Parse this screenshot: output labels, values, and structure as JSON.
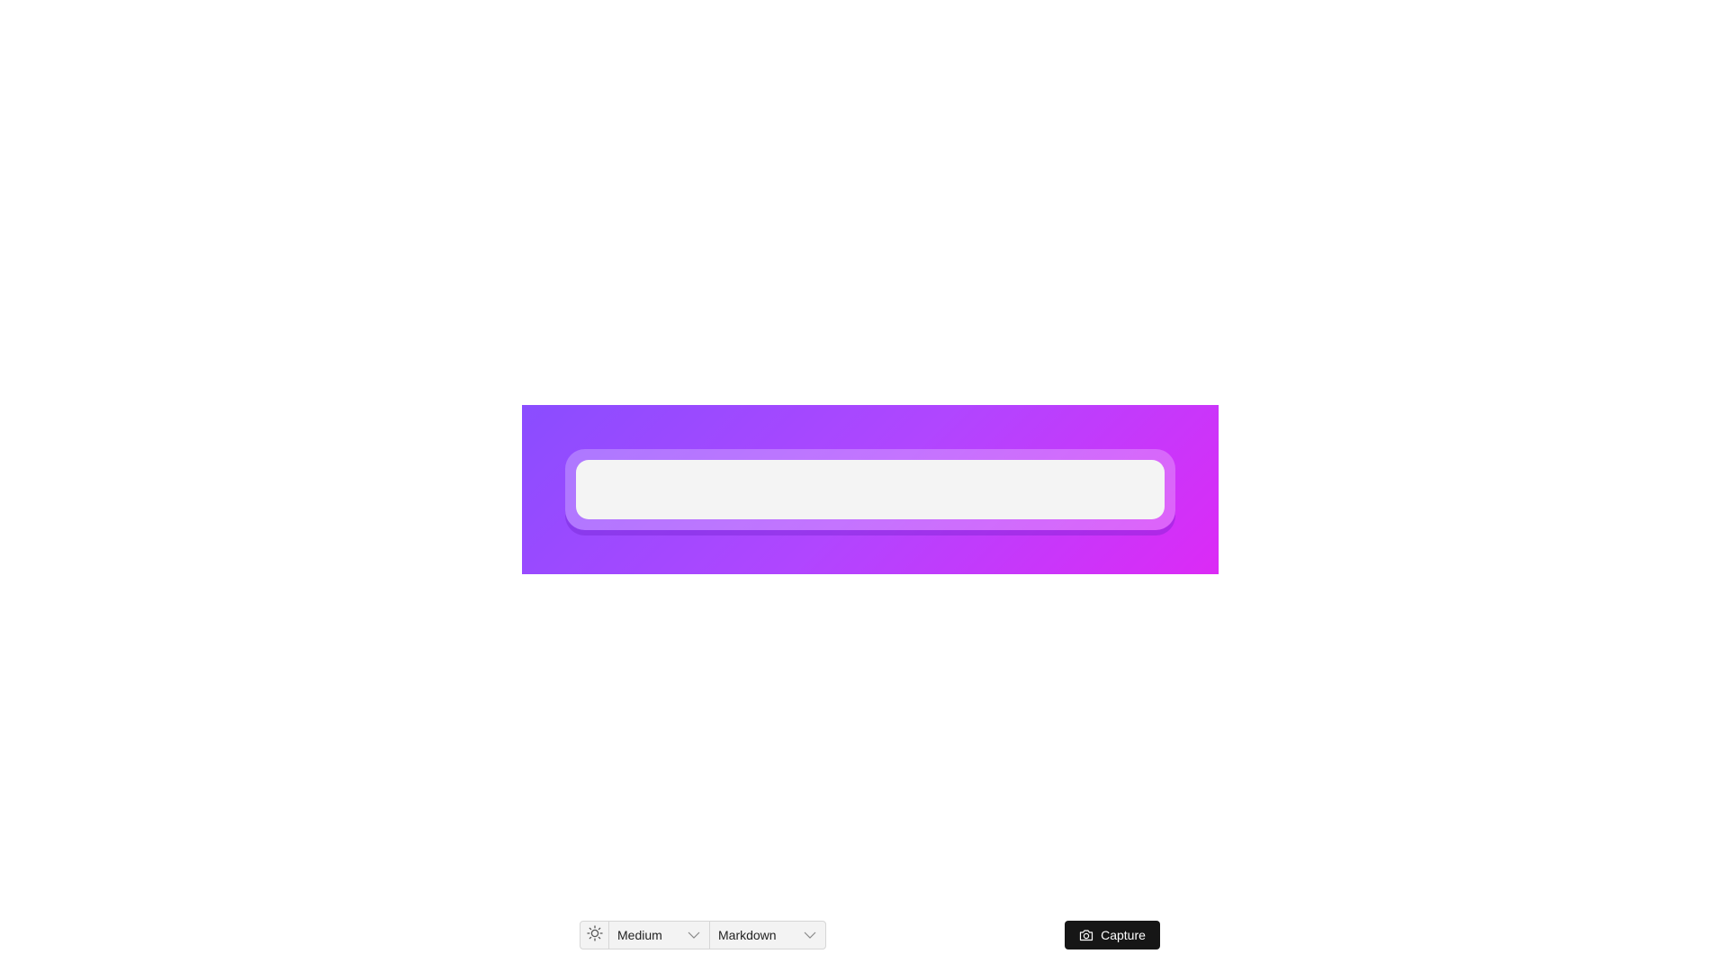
{
  "canvas": {
    "gradient_colors": [
      "#8a4dff",
      "#b046ff",
      "#dc2af6"
    ],
    "editor_text": ""
  },
  "toolbar": {
    "theme_icon": "sun-icon",
    "size_select": {
      "value": "Medium",
      "icon": "chevron-down-icon"
    },
    "format_select": {
      "value": "Markdown",
      "icon": "chevron-down-icon"
    }
  },
  "capture": {
    "label": "Capture",
    "icon": "camera-icon",
    "background": "#161616"
  }
}
